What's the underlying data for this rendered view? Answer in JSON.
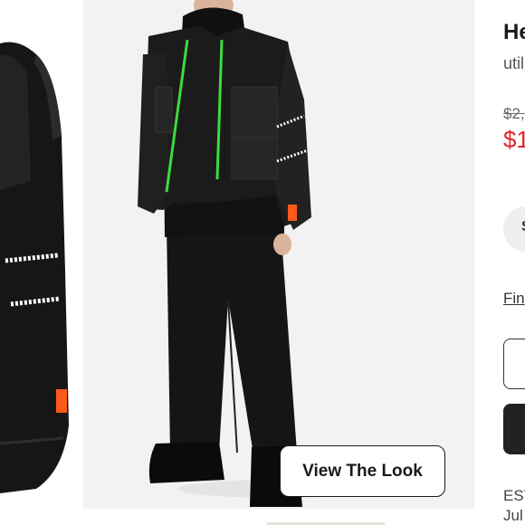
{
  "product": {
    "brand_partial": "He",
    "subtitle_partial": "util",
    "original_price_partial": "$2,",
    "sale_price_partial": "$1",
    "size_pill_partial": "S",
    "find_link_partial": "Fin",
    "outline_button_partial": "",
    "dark_button_label": "",
    "est_label_partial": "EST",
    "est_date_partial": "Jul"
  },
  "gallery": {
    "view_look_label": "View The Look"
  },
  "colors": {
    "sale_red": "#e0242c",
    "accent_green": "#3ddc3d",
    "accent_orange": "#ff5a1a",
    "photo_bg": "#f2f2f2"
  }
}
